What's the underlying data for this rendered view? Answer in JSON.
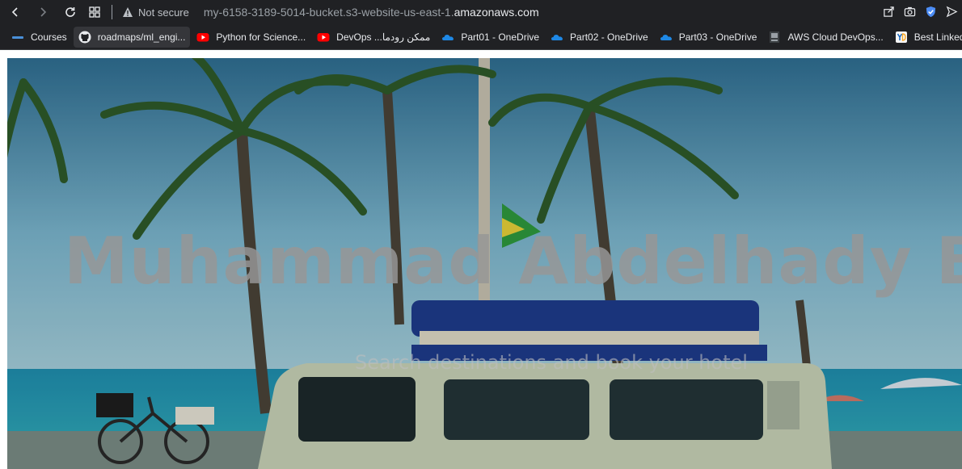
{
  "toolbar": {
    "security_label": "Not secure",
    "url_path": "my-6158-3189-5014-bucket.s3-website-us-east-1.",
    "url_host": "amazonaws.com"
  },
  "bookmarks": [
    {
      "label": "Courses",
      "icon": "folder-icon"
    },
    {
      "label": "roadmaps/ml_engi...",
      "icon": "github-icon"
    },
    {
      "label": "Python for Science...",
      "icon": "youtube-icon"
    },
    {
      "label": "DevOps ...ممكن رودما",
      "icon": "youtube-icon"
    },
    {
      "label": "Part01 - OneDrive",
      "icon": "onedrive-icon"
    },
    {
      "label": "Part02 - OneDrive",
      "icon": "onedrive-icon"
    },
    {
      "label": "Part03 - OneDrive",
      "icon": "onedrive-icon"
    },
    {
      "label": "AWS Cloud DevOps...",
      "icon": "aws-icon"
    },
    {
      "label": "Best LinkedIn Sum",
      "icon": "linkedin-summary-icon"
    }
  ],
  "hero": {
    "title": "Muhammad Abdelhady Blog",
    "subtitle": "Search destinations and book your hotel"
  },
  "colors": {
    "toolbar_bg": "#202124",
    "sky": "#5ea3c4",
    "van": "#c9d3b8"
  }
}
